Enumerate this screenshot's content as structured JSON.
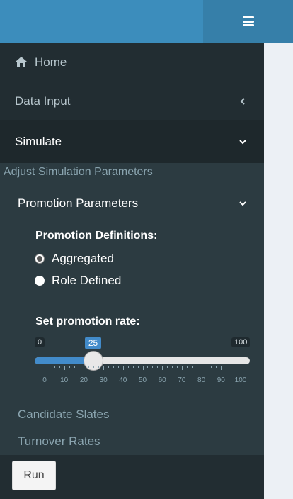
{
  "sidebar": {
    "home_label": "Home",
    "data_input_label": "Data Input",
    "simulate_label": "Simulate",
    "section_label": "Adjust Simulation Parameters",
    "promotion_parameters_label": "Promotion Parameters",
    "candidate_slates_label": "Candidate Slates",
    "turnover_rates_label": "Turnover Rates"
  },
  "promotion": {
    "definitions_label": "Promotion Definitions:",
    "options": [
      "Aggregated",
      "Role Defined"
    ],
    "selected": "Aggregated",
    "rate_label": "Set promotion rate:",
    "slider": {
      "min": "0",
      "max": "100",
      "value": "25",
      "fraction": 0.25
    },
    "ticks": [
      "0",
      "10",
      "20",
      "30",
      "40",
      "50",
      "60",
      "70",
      "80",
      "90",
      "100"
    ]
  },
  "run_label": "Run",
  "icons": {
    "menu": "hamburger-icon",
    "home": "home-icon"
  },
  "colors": {
    "header": "#3c8dbc",
    "sidebar": "#222d32",
    "slider_fill": "#428bca"
  }
}
